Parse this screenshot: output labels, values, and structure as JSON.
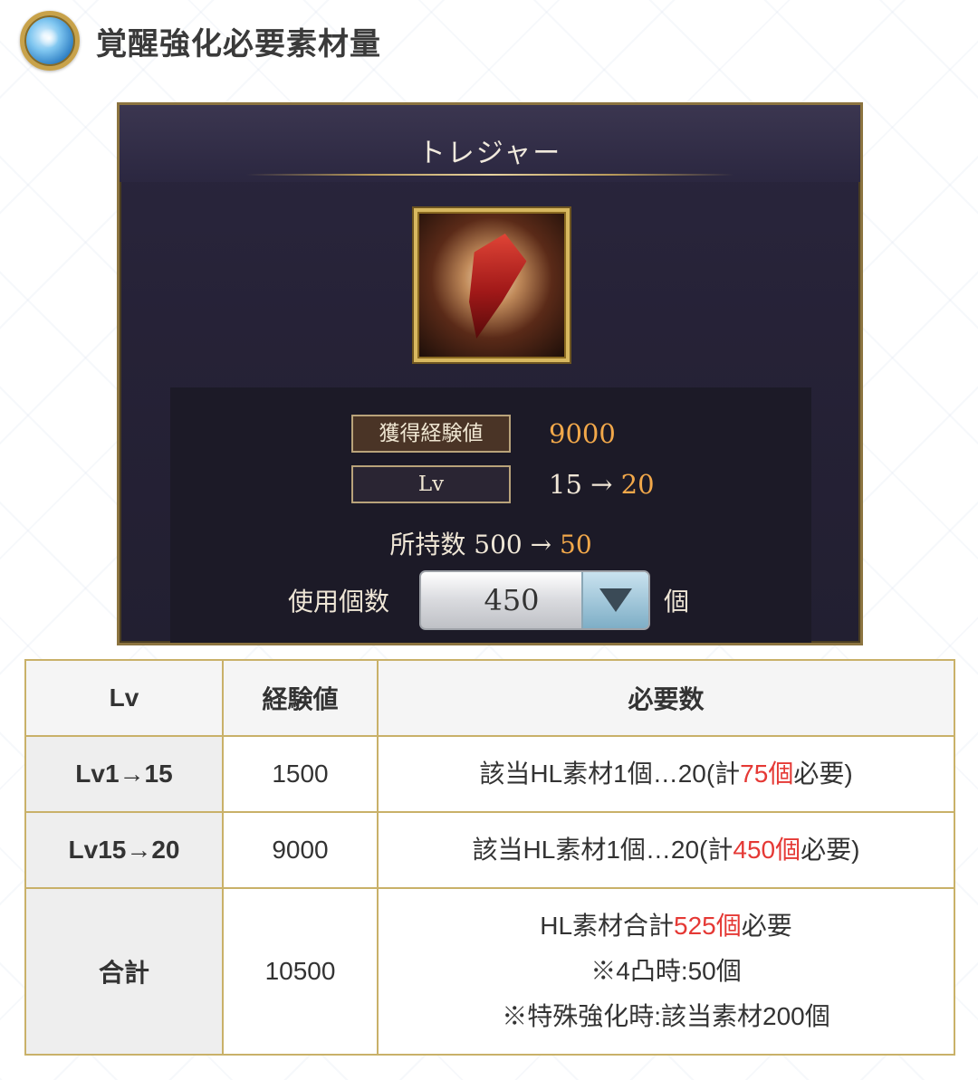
{
  "header": {
    "title": "覚醒強化必要素材量",
    "icon": "crystal-orb-icon"
  },
  "game": {
    "title": "トレジャー",
    "exp_label": "獲得経験値",
    "exp_value": "9000",
    "lv_label": "Lv",
    "lv_from": "15",
    "lv_arrow": "→",
    "lv_to": "20",
    "owned_label": "所持数",
    "owned_from": "500",
    "owned_arrow": "→",
    "owned_to": "50",
    "use_label": "使用個数",
    "use_value": "450",
    "use_unit": "個"
  },
  "table": {
    "headers": [
      "Lv",
      "経験値",
      "必要数"
    ],
    "rows": [
      {
        "lv": "Lv1→15",
        "exp": "1500",
        "need_pre": "該当HL素材1個…20(計",
        "need_red": "75個",
        "need_post": "必要)"
      },
      {
        "lv": "Lv15→20",
        "exp": "9000",
        "need_pre": "該当HL素材1個…20(計",
        "need_red": "450個",
        "need_post": "必要)"
      }
    ],
    "total": {
      "label": "合計",
      "exp": "10500",
      "line1_pre": "HL素材合計",
      "line1_red": "525個",
      "line1_post": "必要",
      "line2": "※4凸時:50個",
      "line3": "※特殊強化時:該当素材200個"
    }
  },
  "colors": {
    "accent_red": "#e53935",
    "gold_border": "#c9b169",
    "game_orange": "#f2a84a"
  }
}
